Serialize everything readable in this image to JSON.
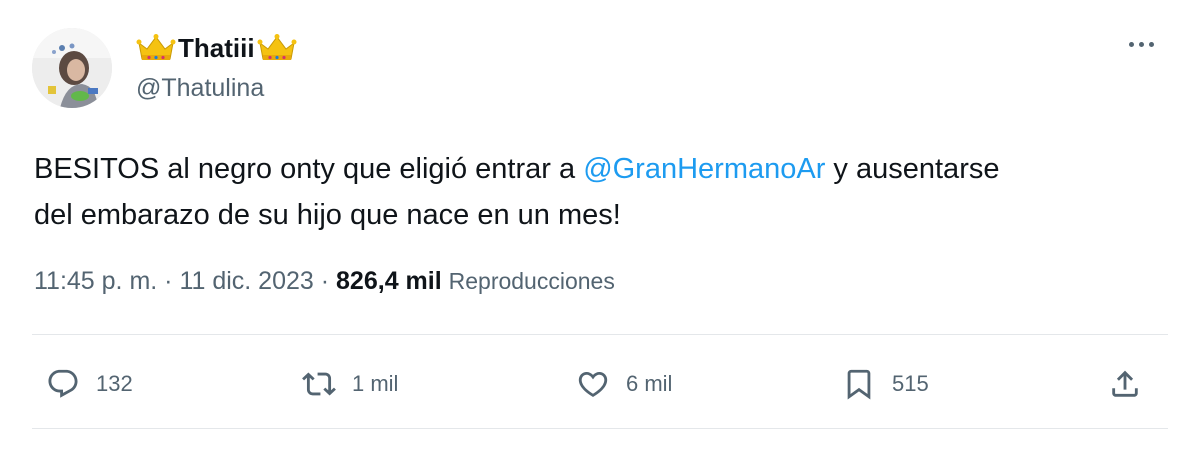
{
  "user": {
    "display_name": "Thatiii",
    "handle": "@Thatulina"
  },
  "tweet": {
    "text_line1_prefix": "BESITOS al negro onty que eligió entrar a ",
    "mention": "@GranHermanoAr",
    "text_line1_suffix": " y ausentarse",
    "text_line2": "del embarazo de su hijo que nace en un mes!",
    "time": "11:45 p. m.",
    "separator": " · ",
    "date": "11 dic. 2023",
    "views_count": "826,4 mil",
    "views_label": "Reproducciones"
  },
  "actions": {
    "replies": "132",
    "retweets": "1 mil",
    "likes": "6 mil",
    "bookmarks": "515"
  },
  "colors": {
    "accent": "#1d9bf0",
    "secondary_text": "#536471",
    "primary_text": "#0f1419",
    "crown": "#f5c211"
  },
  "icons": [
    "crown-icon",
    "more-icon",
    "reply-icon",
    "retweet-icon",
    "like-icon",
    "bookmark-icon",
    "share-icon"
  ]
}
